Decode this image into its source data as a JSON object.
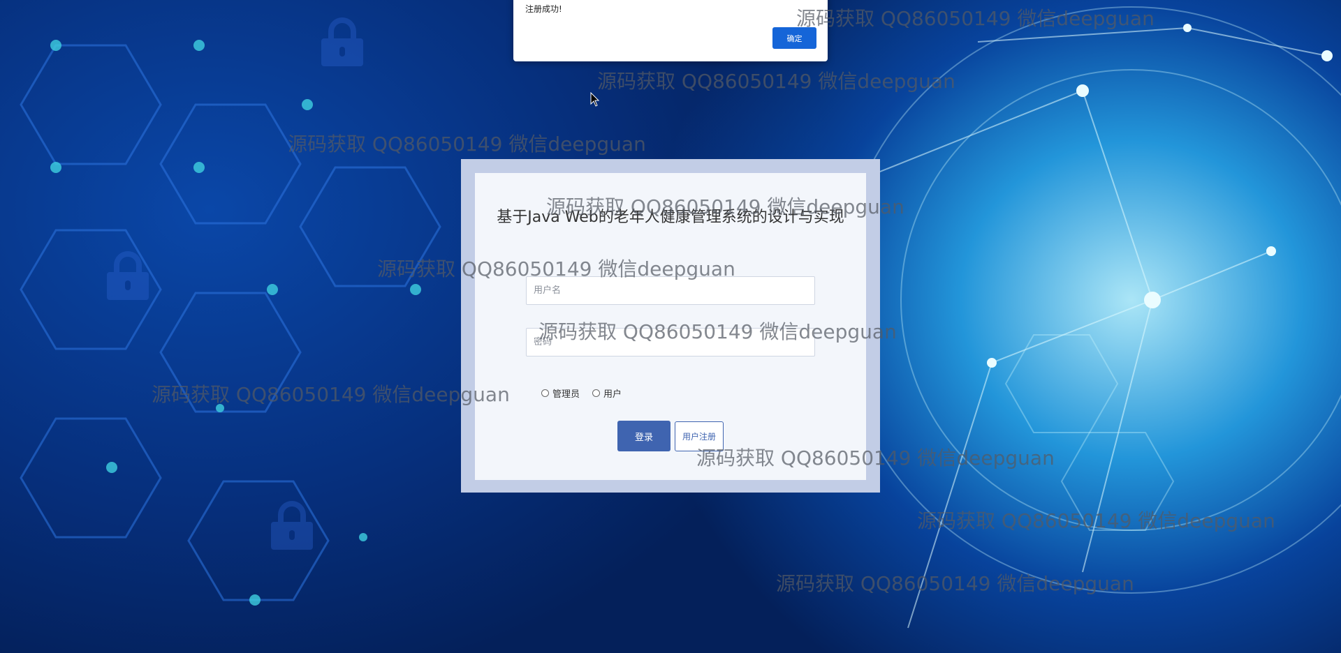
{
  "alert": {
    "message": "注册成功!",
    "ok_label": "确定"
  },
  "login": {
    "title": "基于Java Web的老年人健康管理系统的设计与实现",
    "username_placeholder": "用户名",
    "password_placeholder": "密码",
    "roles": [
      "管理员",
      "用户"
    ],
    "login_label": "登录",
    "register_label": "用户注册"
  },
  "watermark": {
    "text": "源码获取 QQ86050149 微信deepguan"
  },
  "colors": {
    "primary_button": "#3f64b0",
    "dialog_button": "#1565d8",
    "frame": "#c2cde6"
  }
}
